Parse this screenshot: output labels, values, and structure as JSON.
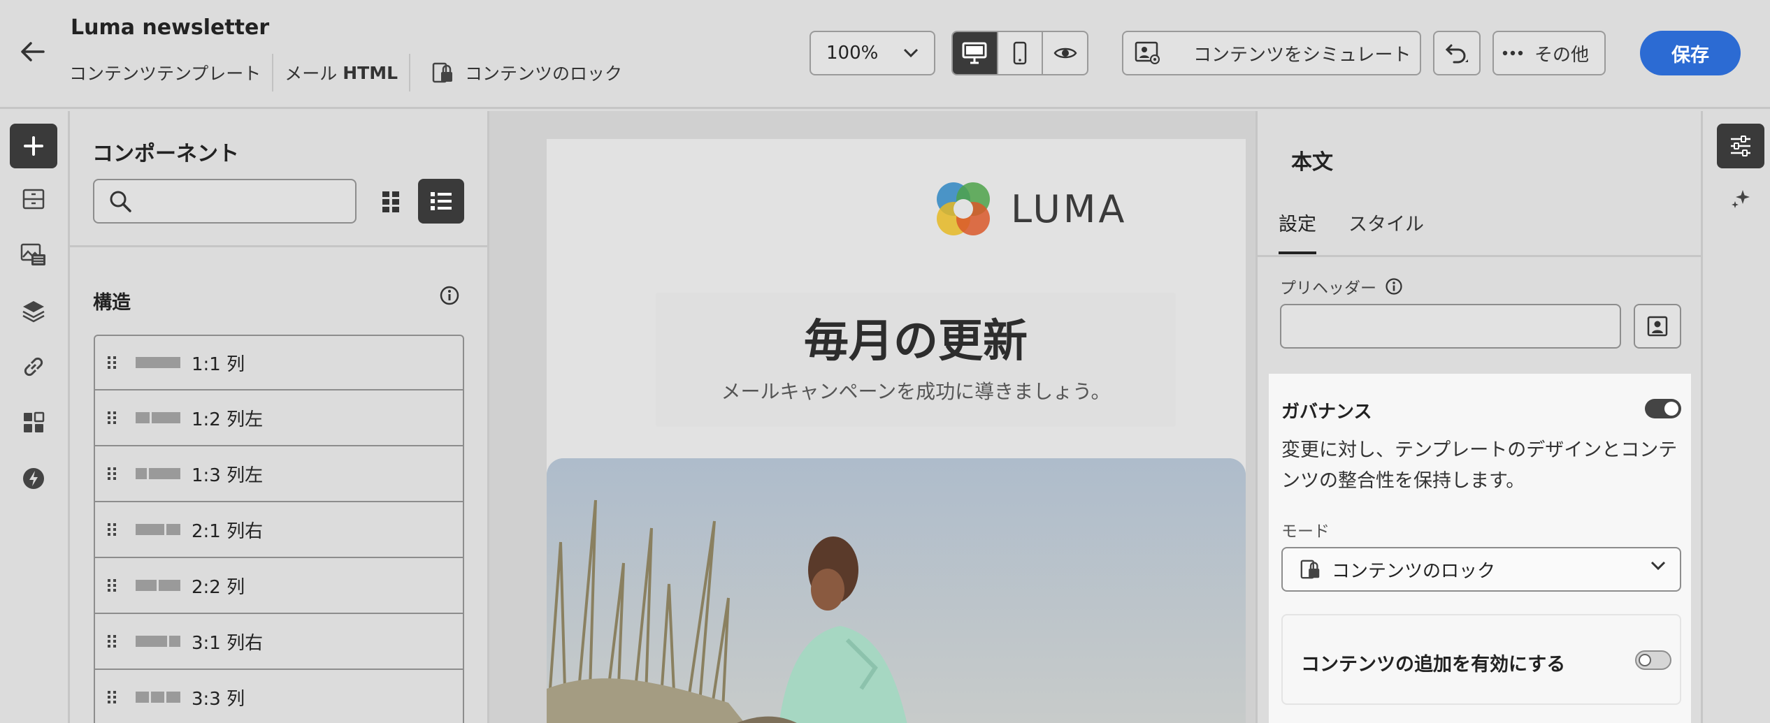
{
  "header": {
    "title": "Luma newsletter",
    "breadcrumb": [
      "コンテンツテンプレート",
      "メール",
      "HTML"
    ],
    "lock_label": "コンテンツのロック",
    "zoom": "100%",
    "simulate_label": "コンテンツをシミュレート",
    "more_label": "その他",
    "save_label": "保存"
  },
  "left_panel": {
    "title": "コンポーネント",
    "search_placeholder": "",
    "section_title": "構造",
    "structures": [
      {
        "label": "1:1 列"
      },
      {
        "label": "1:2 列左"
      },
      {
        "label": "1:3 列左"
      },
      {
        "label": "2:1 列右"
      },
      {
        "label": "2:2 列"
      },
      {
        "label": "3:1 列右"
      },
      {
        "label": "3:3 列"
      }
    ]
  },
  "email": {
    "logo_text": "LUMA",
    "headline": "毎月の更新",
    "subheadline": "メールキャンペーンを成功に導きましょう。"
  },
  "right_panel": {
    "title": "本文",
    "tabs": [
      "設定",
      "スタイル"
    ],
    "active_tab": "設定",
    "preheader_label": "プリヘッダー",
    "preheader_value": "",
    "governance_title": "ガバナンス",
    "governance_on": true,
    "governance_desc": "変更に対し、テンプレートのデザインとコンテンツの整合性を保持します。",
    "mode_label": "モード",
    "mode_value": "コンテンツのロック",
    "add_content_label": "コンテンツの追加を有効にする",
    "add_content_on": false
  },
  "colors": {
    "accent": "#2c6bd3",
    "active_dark": "#3a3a3a",
    "background": "#dcdcdc"
  }
}
